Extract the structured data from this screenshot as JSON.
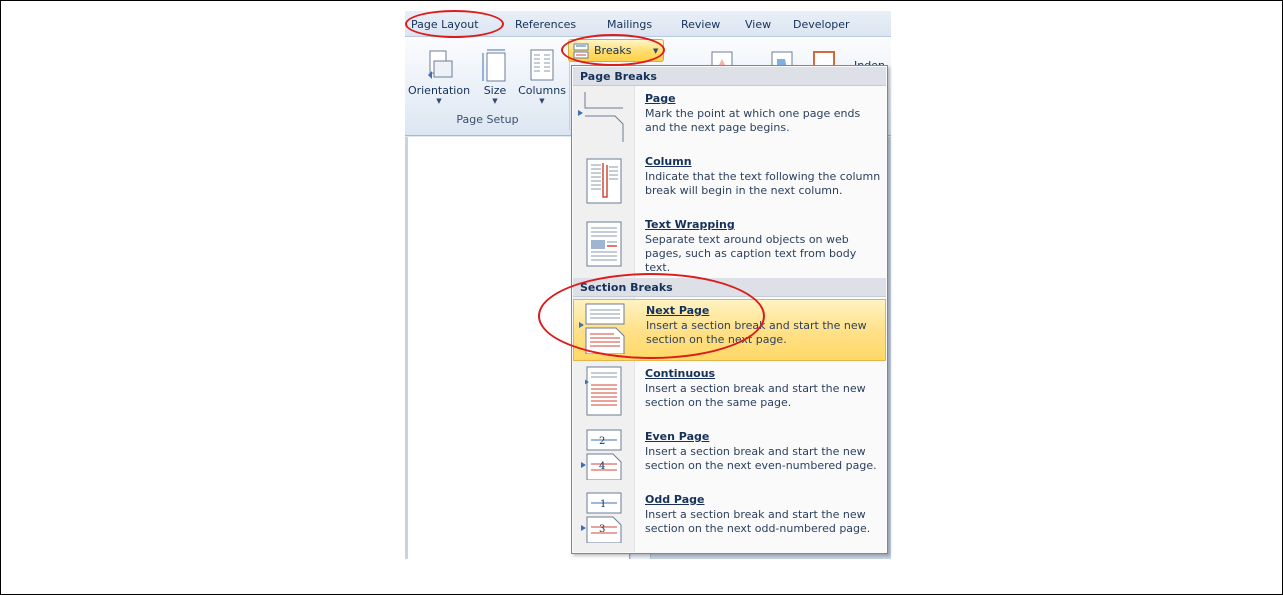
{
  "tabs": [
    {
      "label": "Page Layout"
    },
    {
      "label": "References"
    },
    {
      "label": "Mailings"
    },
    {
      "label": "Review"
    },
    {
      "label": "View"
    },
    {
      "label": "Developer"
    }
  ],
  "ribbon": {
    "orientation_label": "Orientation",
    "size_label": "Size",
    "columns_label": "Columns",
    "group_label": "Page Setup",
    "breaks_label": "Breaks",
    "indent_label": "Inden"
  },
  "menu": {
    "page_breaks_header": "Page Breaks",
    "section_breaks_header": "Section Breaks",
    "items": [
      {
        "title": "Page",
        "desc": "Mark the point at which one page ends and the next page begins."
      },
      {
        "title": "Column",
        "desc": "Indicate that the text following the column break will begin in the next column."
      },
      {
        "title": "Text Wrapping",
        "desc": "Separate text around objects on web pages, such as caption text from body text."
      },
      {
        "title": "Next Page",
        "desc": "Insert a section break and start the new section on the next page."
      },
      {
        "title": "Continuous",
        "desc": "Insert a section break and start the new section on the same page."
      },
      {
        "title": "Even Page",
        "desc": "Insert a section break and start the new section on the next even-numbered page."
      },
      {
        "title": "Odd Page",
        "desc": "Insert a section break and start the new section on the next odd-numbered page."
      }
    ]
  },
  "icons": {
    "even_page_numbers": [
      "2",
      "4"
    ],
    "odd_page_numbers": [
      "1",
      "3"
    ]
  },
  "colors": {
    "annotation": "#dd1b1b",
    "highlight": "#ffe18a"
  }
}
